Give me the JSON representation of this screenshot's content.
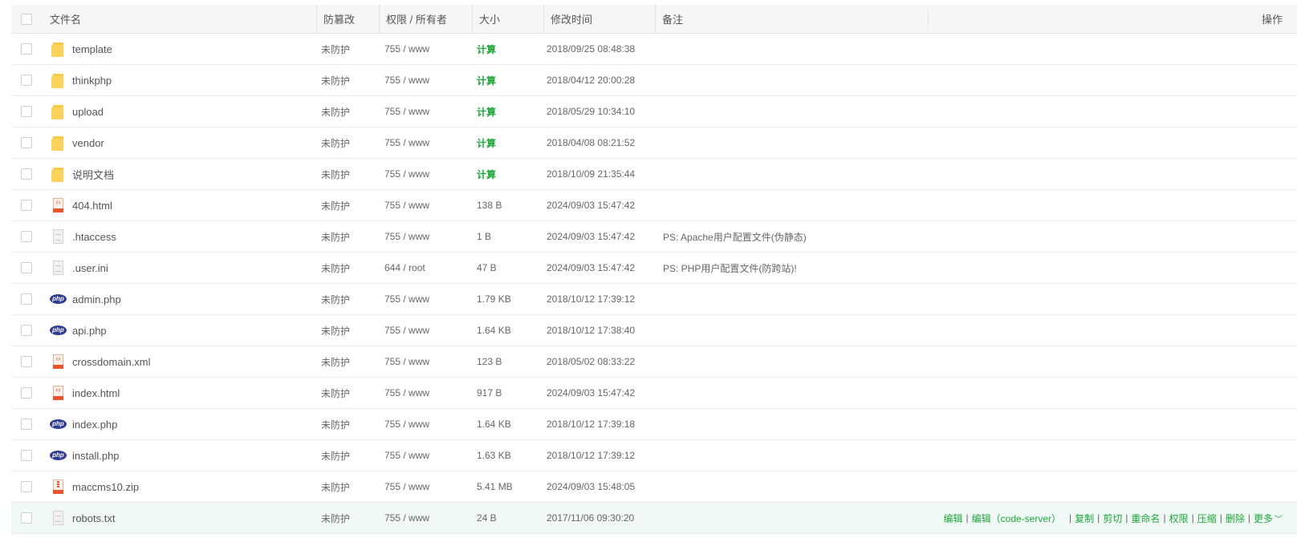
{
  "headers": {
    "name": "文件名",
    "protect": "防篡改",
    "perm": "权限 / 所有者",
    "size": "大小",
    "mtime": "修改时间",
    "note": "备注",
    "action": "操作"
  },
  "rows": [
    {
      "icon": "folder-icon",
      "name": "template",
      "protect": "未防护",
      "perm": "755 / www",
      "size": "计算",
      "size_is_link": true,
      "mtime": "2018/09/25 08:48:38",
      "note": ""
    },
    {
      "icon": "folder-icon",
      "name": "thinkphp",
      "protect": "未防护",
      "perm": "755 / www",
      "size": "计算",
      "size_is_link": true,
      "mtime": "2018/04/12 20:00:28",
      "note": ""
    },
    {
      "icon": "folder-icon",
      "name": "upload",
      "protect": "未防护",
      "perm": "755 / www",
      "size": "计算",
      "size_is_link": true,
      "mtime": "2018/05/29 10:34:10",
      "note": ""
    },
    {
      "icon": "folder-icon",
      "name": "vendor",
      "protect": "未防护",
      "perm": "755 / www",
      "size": "计算",
      "size_is_link": true,
      "mtime": "2018/04/08 08:21:52",
      "note": ""
    },
    {
      "icon": "folder-icon",
      "name": "说明文档",
      "protect": "未防护",
      "perm": "755 / www",
      "size": "计算",
      "size_is_link": true,
      "mtime": "2018/10/09 21:35:44",
      "note": ""
    },
    {
      "icon": "html-icon",
      "name": "404.html",
      "protect": "未防护",
      "perm": "755 / www",
      "size": "138 B",
      "mtime": "2024/09/03 15:47:42",
      "note": ""
    },
    {
      "icon": "doc-icon",
      "name": ".htaccess",
      "protect": "未防护",
      "perm": "755 / www",
      "size": "1 B",
      "mtime": "2024/09/03 15:47:42",
      "note": "PS: Apache用户配置文件(伪静态)"
    },
    {
      "icon": "doc-icon",
      "name": ".user.ini",
      "protect": "未防护",
      "perm": "644 / root",
      "size": "47 B",
      "mtime": "2024/09/03 15:47:42",
      "note": "PS: PHP用户配置文件(防跨站)!"
    },
    {
      "icon": "php-icon",
      "name": "admin.php",
      "protect": "未防护",
      "perm": "755 / www",
      "size": "1.79 KB",
      "mtime": "2018/10/12 17:39:12",
      "note": ""
    },
    {
      "icon": "php-icon",
      "name": "api.php",
      "protect": "未防护",
      "perm": "755 / www",
      "size": "1.64 KB",
      "mtime": "2018/10/12 17:38:40",
      "note": ""
    },
    {
      "icon": "html-icon",
      "name": "crossdomain.xml",
      "protect": "未防护",
      "perm": "755 / www",
      "size": "123 B",
      "mtime": "2018/05/02 08:33:22",
      "note": ""
    },
    {
      "icon": "html-icon",
      "name": "index.html",
      "protect": "未防护",
      "perm": "755 / www",
      "size": "917 B",
      "mtime": "2024/09/03 15:47:42",
      "note": ""
    },
    {
      "icon": "php-icon",
      "name": "index.php",
      "protect": "未防护",
      "perm": "755 / www",
      "size": "1.64 KB",
      "mtime": "2018/10/12 17:39:18",
      "note": ""
    },
    {
      "icon": "php-icon",
      "name": "install.php",
      "protect": "未防护",
      "perm": "755 / www",
      "size": "1.63 KB",
      "mtime": "2018/10/12 17:39:12",
      "note": ""
    },
    {
      "icon": "zip-icon",
      "name": "maccms10.zip",
      "protect": "未防护",
      "perm": "755 / www",
      "size": "5.41 MB",
      "mtime": "2024/09/03 15:48:05",
      "note": ""
    },
    {
      "icon": "doc-icon",
      "name": "robots.txt",
      "protect": "未防护",
      "perm": "755 / www",
      "size": "24 B",
      "mtime": "2017/11/06 09:30:20",
      "note": "",
      "active": true
    }
  ],
  "row_actions": [
    {
      "key": "edit",
      "label": "编辑"
    },
    {
      "key": "edit-code-server",
      "label": "编辑（code-server）"
    },
    {
      "key": "copy",
      "label": "复制"
    },
    {
      "key": "cut",
      "label": "剪切"
    },
    {
      "key": "rename",
      "label": "重命名"
    },
    {
      "key": "permission",
      "label": "权限"
    },
    {
      "key": "compress",
      "label": "压缩"
    },
    {
      "key": "delete",
      "label": "删除"
    },
    {
      "key": "more",
      "label": "更多"
    }
  ],
  "colors": {
    "accent": "#20a53a",
    "active_row": "#f0f9f6"
  }
}
